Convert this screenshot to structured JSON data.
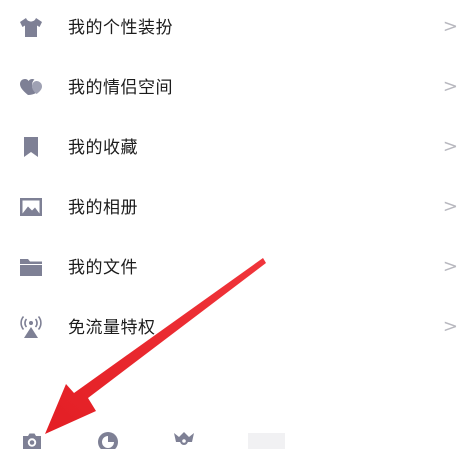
{
  "colors": {
    "icon": "#7e8095",
    "text": "#1c1c1c",
    "chevron": "#b8b8bf",
    "arrow": "#e8242b"
  },
  "menu": {
    "items": [
      {
        "label": "我的个性装扮",
        "icon": "tshirt-icon",
        "chevron": ">"
      },
      {
        "label": "我的情侣空间",
        "icon": "hearts-icon",
        "chevron": ">"
      },
      {
        "label": "我的收藏",
        "icon": "bookmark-icon",
        "chevron": ">"
      },
      {
        "label": "我的相册",
        "icon": "photo-icon",
        "chevron": ">"
      },
      {
        "label": "我的文件",
        "icon": "folder-icon",
        "chevron": ">"
      },
      {
        "label": "免流量特权",
        "icon": "signal-tower-icon",
        "chevron": ">"
      }
    ]
  },
  "bottom_bar": {
    "icons": [
      "camera-icon",
      "moon-icon",
      "badge-icon"
    ]
  },
  "annotation": {
    "type": "arrow",
    "target": "camera-icon"
  }
}
